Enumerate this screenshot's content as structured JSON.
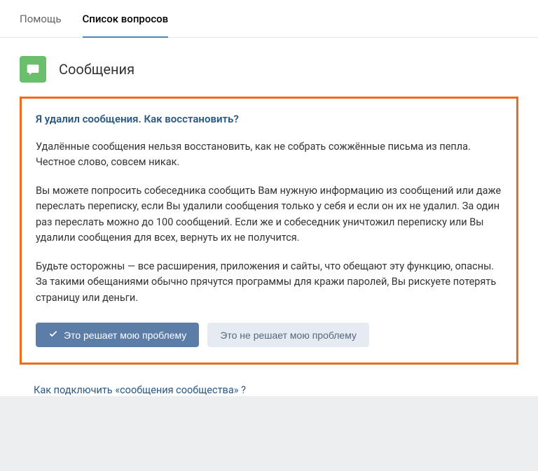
{
  "tabs": {
    "help": "Помощь",
    "questions": "Список вопросов"
  },
  "section": {
    "title": "Сообщения"
  },
  "faq": {
    "question": "Я удалил сообщения. Как восстановить?",
    "p1": "Удалённые сообщения нельзя восстановить, как не собрать сожжённые письма из пепла. Честное слово, совсем никак.",
    "p2": "Вы можете попросить собеседника сообщить Вам нужную информацию из сообщений или даже переслать переписку, если Вы удалили сообщения только у себя и если он их не удалил. За один раз переслать можно до 100 сообщений. Если же и собеседник уничтожил переписку или Вы удалили сообщения для всех, вернуть их не получится.",
    "p3": "Будьте осторожны — все расширения, приложения и сайты, что обещают эту функцию, опасны. За такими обещаниями обычно прячутся программы для кражи паролей, Вы рискуете потерять страницу или деньги."
  },
  "buttons": {
    "solves": "Это решает мою проблему",
    "not_solves": "Это не решает мою проблему"
  },
  "related": {
    "link1": "Как подключить «сообщения сообщества» ?"
  }
}
